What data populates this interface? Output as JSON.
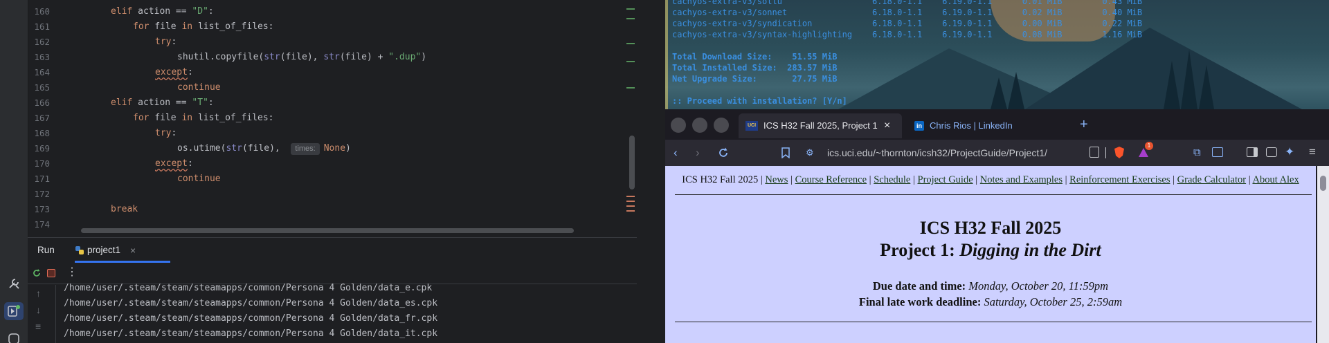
{
  "ide": {
    "lines": [
      {
        "n": "160",
        "indent": 2,
        "parts": [
          [
            "kw",
            "elif "
          ],
          [
            "",
            "action == "
          ],
          [
            "str",
            "\"D\""
          ],
          [
            "",
            ":"
          ]
        ]
      },
      {
        "n": "161",
        "indent": 3,
        "parts": [
          [
            "kw",
            "for "
          ],
          [
            "",
            "file "
          ],
          [
            "kw",
            "in "
          ],
          [
            "",
            "list_of_files:"
          ]
        ]
      },
      {
        "n": "162",
        "indent": 4,
        "parts": [
          [
            "kw",
            "try"
          ],
          [
            "",
            ":"
          ]
        ]
      },
      {
        "n": "163",
        "indent": 5,
        "parts": [
          [
            "",
            "shutil.copyfile("
          ],
          [
            "bi",
            "str"
          ],
          [
            "",
            "(file), "
          ],
          [
            "bi",
            "str"
          ],
          [
            "",
            "(file) + "
          ],
          [
            "str",
            "\".dup\""
          ],
          [
            "",
            ")"
          ]
        ]
      },
      {
        "n": "164",
        "indent": 4,
        "parts": [
          [
            "kw sq",
            "except"
          ],
          [
            "",
            ":"
          ]
        ]
      },
      {
        "n": "165",
        "indent": 5,
        "parts": [
          [
            "kw",
            "continue"
          ]
        ]
      },
      {
        "n": "166",
        "indent": 2,
        "parts": [
          [
            "kw",
            "elif "
          ],
          [
            "",
            "action == "
          ],
          [
            "str",
            "\"T\""
          ],
          [
            "",
            ":"
          ]
        ]
      },
      {
        "n": "167",
        "indent": 3,
        "parts": [
          [
            "kw",
            "for "
          ],
          [
            "",
            "file "
          ],
          [
            "kw",
            "in "
          ],
          [
            "",
            "list_of_files:"
          ]
        ]
      },
      {
        "n": "168",
        "indent": 4,
        "parts": [
          [
            "kw",
            "try"
          ],
          [
            "",
            ":"
          ]
        ]
      },
      {
        "n": "169",
        "indent": 5,
        "parts": [
          [
            "",
            "os.utime("
          ],
          [
            "bi",
            "str"
          ],
          [
            "",
            "(file),  "
          ],
          [
            "hint",
            "times:"
          ],
          [
            "kw",
            "None"
          ],
          [
            "",
            ")"
          ]
        ]
      },
      {
        "n": "170",
        "indent": 4,
        "parts": [
          [
            "kw sq",
            "except"
          ],
          [
            "",
            ":"
          ]
        ]
      },
      {
        "n": "171",
        "indent": 5,
        "parts": [
          [
            "kw",
            "continue"
          ]
        ]
      },
      {
        "n": "172",
        "indent": 0,
        "parts": []
      },
      {
        "n": "173",
        "indent": 2,
        "parts": [
          [
            "kw",
            "break"
          ]
        ]
      },
      {
        "n": "174",
        "indent": 0,
        "parts": []
      }
    ],
    "run_tab": "Run",
    "project_tab": "project1",
    "close_glyph": "×",
    "output_lines": [
      "/home/user/.steam/steam/steamapps/common/Persona 4 Golden/data_e.cpk",
      "/home/user/.steam/steam/steamapps/common/Persona 4 Golden/data_es.cpk",
      "/home/user/.steam/steam/steamapps/common/Persona 4 Golden/data_fr.cpk",
      "/home/user/.steam/steam/steamapps/common/Persona 4 Golden/data_it.cpk"
    ],
    "colors": {
      "keyword": "#cf8e6d",
      "string": "#6aab73",
      "builtin": "#8888c6",
      "text": "#bcbec4"
    }
  },
  "terminal": {
    "lines": [
      "cachyos-extra-v3/sollu                  6.18.0-1.1    6.19.0-1.1      0.01 MiB        0.43 MiB",
      "cachyos-extra-v3/sonnet                 6.18.0-1.1    6.19.0-1.1      0.02 MiB        0.40 MiB",
      "cachyos-extra-v3/syndication            6.18.0-1.1    6.19.0-1.1      0.00 MiB        0.22 MiB",
      "cachyos-extra-v3/syntax-highlighting    6.18.0-1.1    6.19.0-1.1      0.08 MiB        1.16 MiB",
      "",
      "Total Download Size:    51.55 MiB",
      "Total Installed Size:  283.57 MiB",
      "Net Upgrade Size:       27.75 MiB",
      "",
      ":: Proceed with installation? [Y/n] "
    ]
  },
  "browser": {
    "tabs": [
      {
        "title": "ICS H32 Fall 2025, Project 1: Digging in the Dirt",
        "favicon": "UCI"
      },
      {
        "title": "Chris Rios | LinkedIn",
        "favicon": "in"
      }
    ],
    "close_glyph": "×",
    "new_tab_glyph": "+",
    "url": "ics.uci.edu/~thornton/icsh32/ProjectGuide/Project1/",
    "shield_badge": "1",
    "nav": {
      "course": "ICS H32 Fall 2025",
      "links": [
        "News",
        "Course Reference",
        "Schedule",
        "Project Guide",
        "Notes and Examples",
        "Reinforcement Exercises",
        "Grade Calculator",
        "About Alex"
      ]
    },
    "page_title": "ICS H32 Fall 2025",
    "subtitle_prefix": "Project 1: ",
    "subtitle_italic": "Digging in the Dirt",
    "due_label": "Due date and time:",
    "due_value": "Monday, October 20, 11:59pm",
    "late_label": "Final late work deadline:",
    "late_value": "Saturday, October 25, 2:59am"
  }
}
